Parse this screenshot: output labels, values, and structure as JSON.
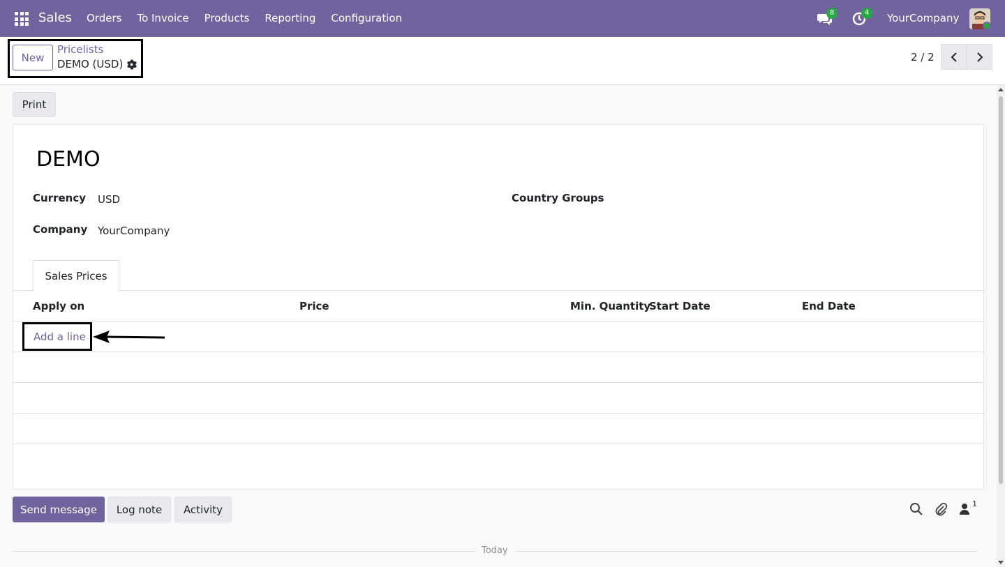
{
  "navbar": {
    "brand": "Sales",
    "menu": [
      "Orders",
      "To Invoice",
      "Products",
      "Reporting",
      "Configuration"
    ],
    "messages_count": "8",
    "activities_count": "4",
    "company": "YourCompany"
  },
  "control_panel": {
    "new_label": "New",
    "breadcrumb_parent": "Pricelists",
    "breadcrumb_current": "DEMO (USD)",
    "pager": "2 / 2"
  },
  "form": {
    "print_label": "Print",
    "name": "DEMO",
    "currency_label": "Currency",
    "currency_value": "USD",
    "company_label": "Company",
    "company_value": "YourCompany",
    "country_groups_label": "Country Groups",
    "tab_label": "Sales Prices",
    "columns": [
      "Apply on",
      "Price",
      "Min. Quantity",
      "Start Date",
      "End Date"
    ],
    "add_line_label": "Add a line"
  },
  "chatter": {
    "send_message_label": "Send message",
    "log_note_label": "Log note",
    "activity_label": "Activity",
    "followers_count": "1",
    "today_label": "Today"
  },
  "colors": {
    "brand": "#71639e",
    "badge": "#28a745"
  }
}
